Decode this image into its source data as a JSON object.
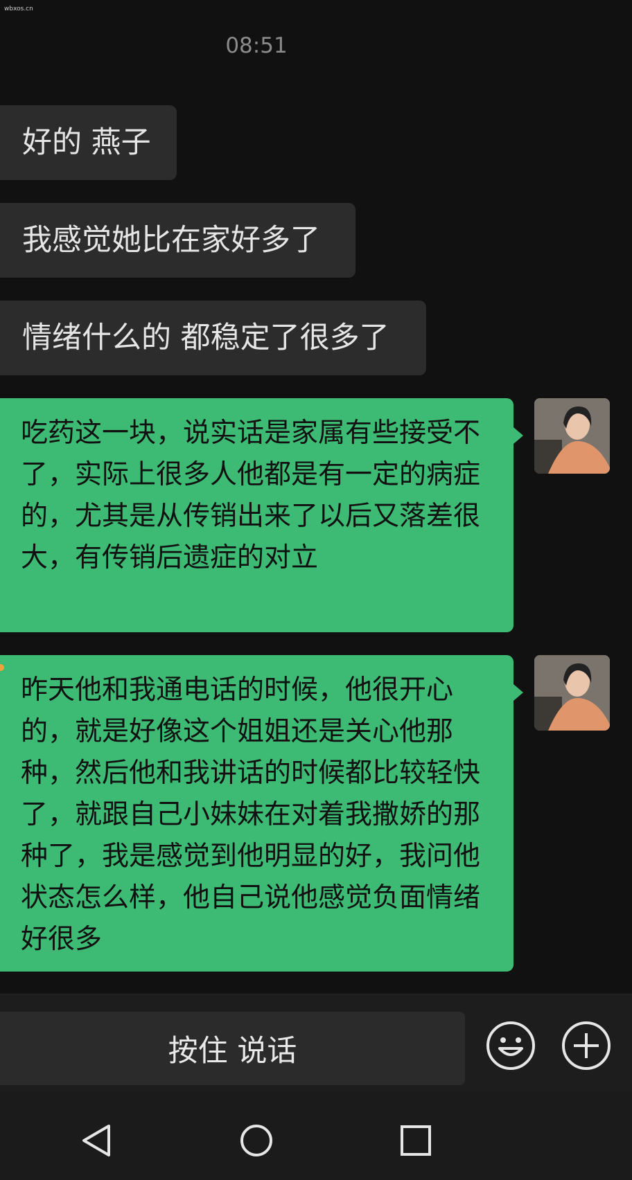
{
  "watermark": "wbxos.cn",
  "timestamp": "08:51",
  "messages_received": [
    {
      "text": "好的 燕子"
    },
    {
      "text": "我感觉她比在家好多了"
    },
    {
      "text": "情绪什么的 都稳定了很多了"
    }
  ],
  "messages_sent": [
    {
      "text": "吃药这一块，说实话是家属有些接受不了，实际上很多人他都是有一定的病症的，尤其是从传销出来了以后又落差很大，有传销后遗症的对立"
    },
    {
      "text": "昨天他和我通电话的时候，他很开心的，就是好像这个姐姐还是关心他那种，然后他和我讲话的时候都比较轻快了，就跟自己小妹妹在对着我撒娇的那种了，我是感觉到他明显的好，我问他状态怎么样，他自己说他感觉负面情绪好很多"
    }
  ],
  "input_bar": {
    "voice_button_label": "按住 说话",
    "emoji_icon": "emoji-icon",
    "plus_icon": "plus-icon"
  },
  "nav": {
    "back_icon": "back-triangle-icon",
    "home_icon": "home-circle-icon",
    "recents_icon": "recents-square-icon"
  },
  "colors": {
    "background": "#111111",
    "received_bubble": "#2c2c2c",
    "sent_bubble": "#3dbb74"
  }
}
